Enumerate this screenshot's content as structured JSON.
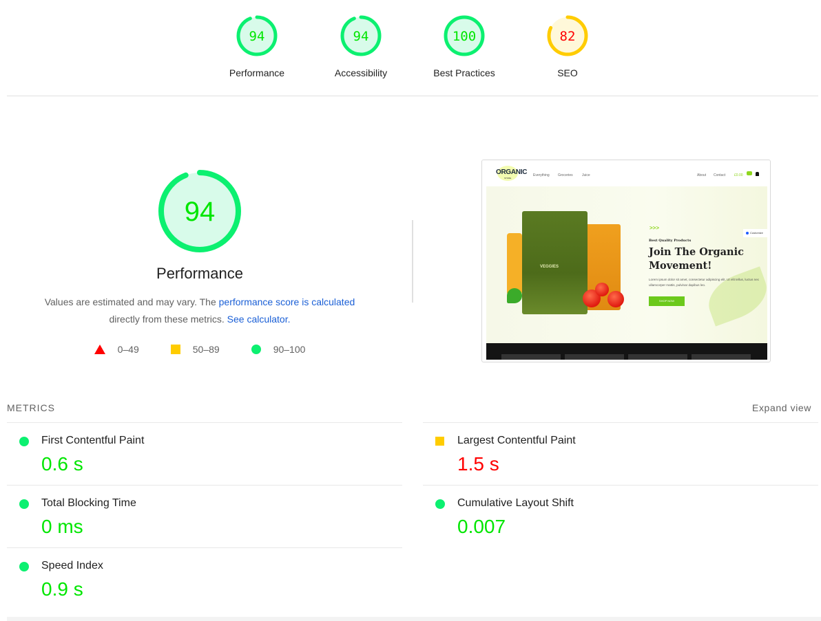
{
  "colors": {
    "pass": "#0cf070",
    "pass_text": "#00cc44",
    "average": "#ffcc00",
    "fail": "#ff0000",
    "pass_bg": "#d8fbea",
    "average_bg": "#fff8d9",
    "link": "#1a5fd6"
  },
  "summary_gauges": [
    {
      "label": "Performance",
      "score": "94",
      "status": "pass"
    },
    {
      "label": "Accessibility",
      "score": "94",
      "status": "pass"
    },
    {
      "label": "Best Practices",
      "score": "100",
      "status": "pass"
    },
    {
      "label": "SEO",
      "score": "82",
      "status": "average"
    }
  ],
  "performance": {
    "score": "94",
    "title": "Performance",
    "desc_prefix": "Values are estimated and may vary. The ",
    "desc_link1": "performance score is calculated",
    "desc_middle": " directly from these metrics. ",
    "desc_link2": "See calculator.",
    "legend": [
      {
        "icon": "triangle-fail-icon",
        "range": "0–49"
      },
      {
        "icon": "square-average-icon",
        "range": "50–89"
      },
      {
        "icon": "circle-pass-icon",
        "range": "90–100"
      }
    ]
  },
  "screenshot": {
    "logo": "ORGANIC",
    "logo_sub": "STORE",
    "nav_left": [
      "Everything",
      "Groceries",
      "Juice"
    ],
    "nav_right": [
      "About",
      "Contact"
    ],
    "cart_price": "£0.00",
    "bag_label": "VEGGIES",
    "subtitle": "Best Quality Products",
    "headline": "Join The Organic Movement!",
    "lorem": "Lorem ipsum dolor sit amet, consectetur adipiscing elit. Ut elit tellus, luctus nec ullamcorper mattis, pulvinar dapibus leo.",
    "button": "SHOP NOW",
    "customize": "Customize"
  },
  "metrics": {
    "header": "METRICS",
    "expand_label": "Expand view",
    "left": [
      {
        "name": "First Contentful Paint",
        "value": "0.6 s",
        "status": "pass"
      },
      {
        "name": "Total Blocking Time",
        "value": "0 ms",
        "status": "pass"
      },
      {
        "name": "Speed Index",
        "value": "0.9 s",
        "status": "pass"
      }
    ],
    "right": [
      {
        "name": "Largest Contentful Paint",
        "value": "1.5 s",
        "status": "average"
      },
      {
        "name": "Cumulative Layout Shift",
        "value": "0.007",
        "status": "pass"
      }
    ]
  }
}
